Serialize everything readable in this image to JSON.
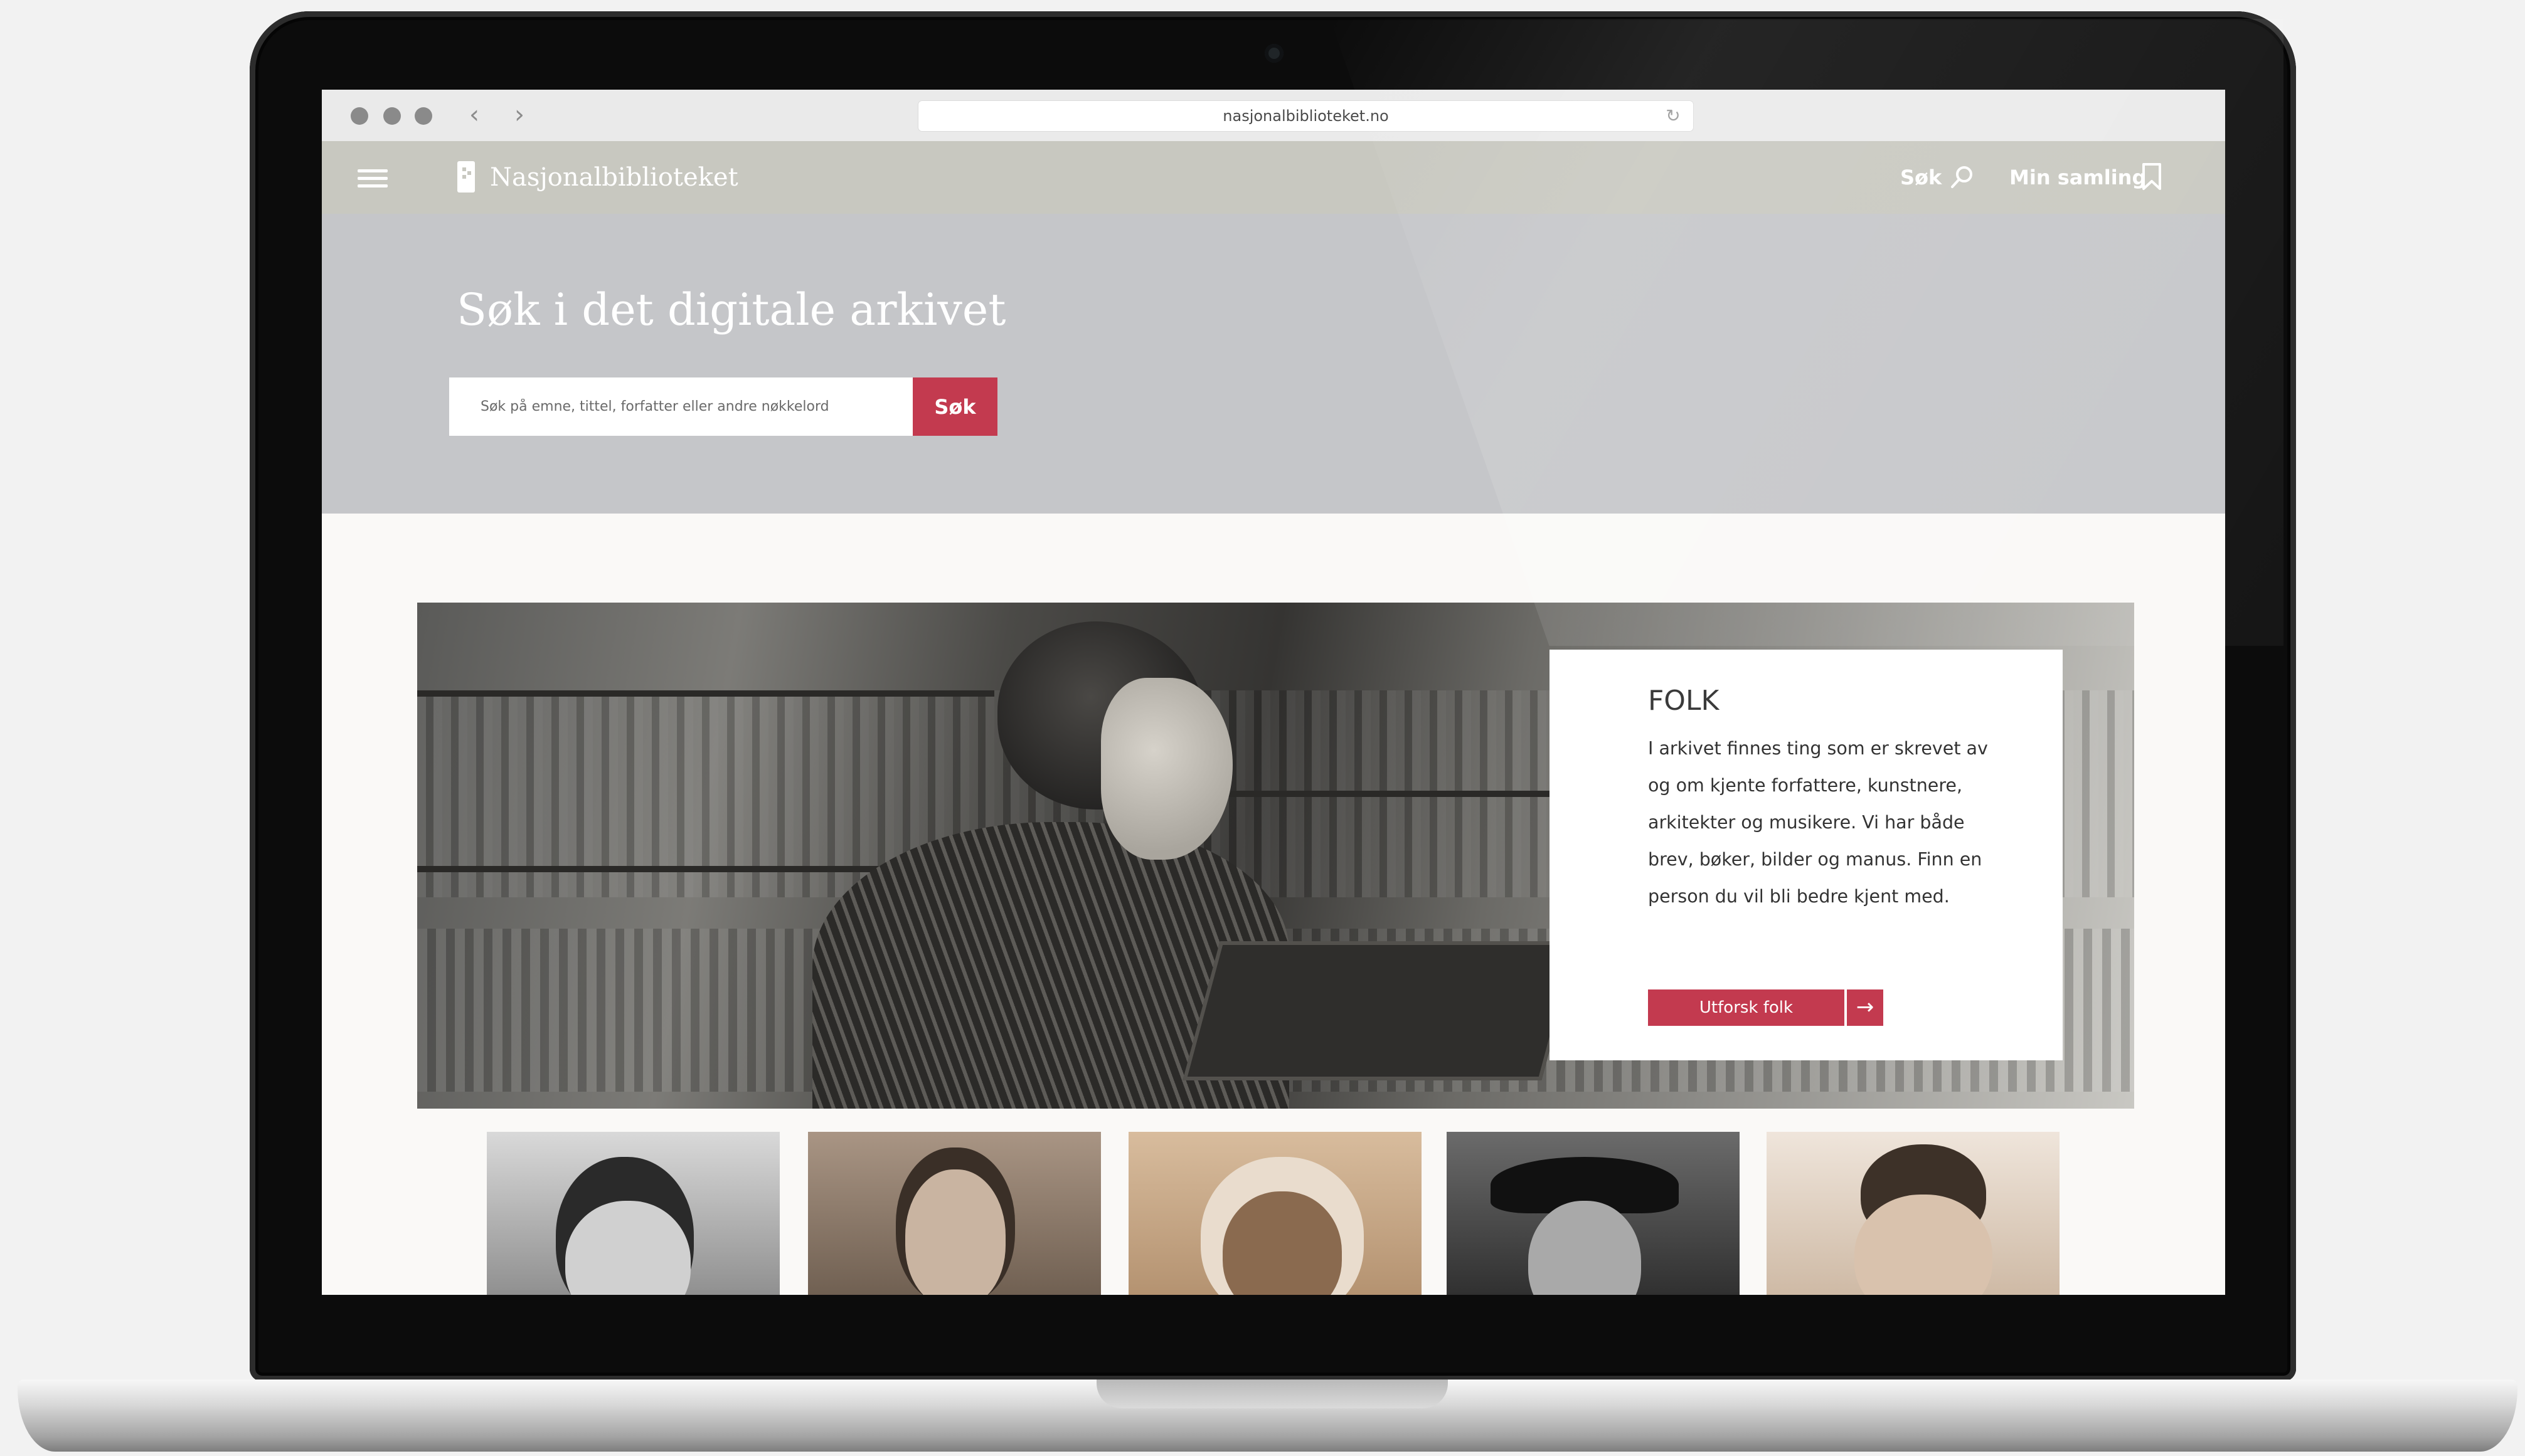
{
  "browser": {
    "url": "nasjonalbiblioteket.no",
    "back_icon": "chevron-left-icon",
    "forward_icon": "chevron-right-icon",
    "reload_icon": "reload-icon"
  },
  "header": {
    "brand": "Nasjonalbiblioteket",
    "menu_icon": "hamburger-menu-icon",
    "search_label": "Søk",
    "collection_label": "Min samling"
  },
  "hero": {
    "title": "Søk i det digitale arkivet",
    "search_placeholder": "Søk på emne, tittel, forfatter eller andre nøkkelord",
    "search_button": "Søk"
  },
  "feature": {
    "title": "FOLK",
    "text": "I arkivet finnes ting som er skrevet av og om kjente forfattere, kunstnere, arkitekter og musikere. Vi har både brev, bøker, bilder og manus. Finn en person du vil bli bedre kjent med.",
    "button": "Utforsk folk",
    "arrow_icon": "arrow-right-icon"
  },
  "portraits": [
    {
      "tone": "#8d8d8d"
    },
    {
      "tone": "#9c8a78"
    },
    {
      "tone": "#c7a98a"
    },
    {
      "tone": "#5d5d5d"
    },
    {
      "tone": "#cfbba7"
    }
  ],
  "colors": {
    "accent": "#c33a4f",
    "header_bg": "#c8c8c0",
    "hero_bg": "#c5c6c9"
  }
}
